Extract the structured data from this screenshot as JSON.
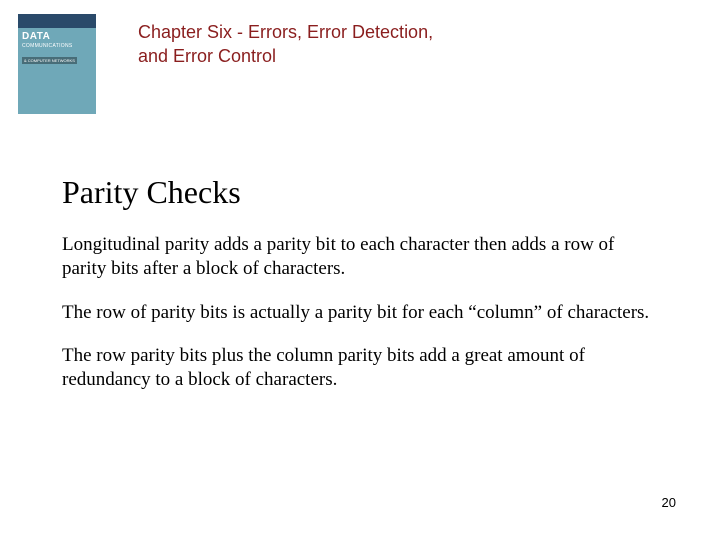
{
  "header": {
    "book_cover": {
      "main": "DATA",
      "sub1": "COMMUNICATIONS",
      "sub2": "& COMPUTER NETWORKS"
    },
    "chapter_title": "Chapter Six - Errors, Error Detection, and Error Control"
  },
  "slide": {
    "heading": "Parity Checks",
    "paragraphs": [
      "Longitudinal parity adds a parity bit to each character then adds a row of parity bits after a block of characters.",
      "The row of parity bits is actually a parity bit for each “column” of characters.",
      "The row parity bits plus the column parity bits add a great amount of redundancy to a block of characters."
    ]
  },
  "page_number": "20"
}
